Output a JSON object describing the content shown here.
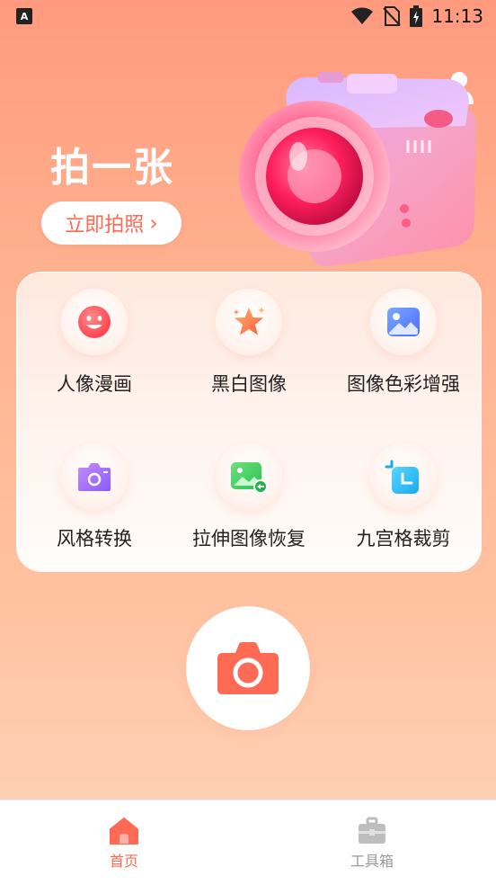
{
  "status_bar": {
    "left_icon_label": "A",
    "time": "11:13"
  },
  "hero": {
    "title": "拍一张",
    "button_label": "立即拍照",
    "button_chevron": "›"
  },
  "features": [
    {
      "label": "人像漫画",
      "icon": "smiley-face-icon"
    },
    {
      "label": "黑白图像",
      "icon": "star-icon"
    },
    {
      "label": "图像色彩增强",
      "icon": "picture-icon"
    },
    {
      "label": "风格转换",
      "icon": "purple-camera-icon"
    },
    {
      "label": "拉伸图像恢复",
      "icon": "green-image-restore-icon"
    },
    {
      "label": "九宫格裁剪",
      "icon": "crop-icon"
    }
  ],
  "bottom_nav": {
    "items": [
      {
        "label": "首页",
        "icon": "home-icon",
        "active": true
      },
      {
        "label": "工具箱",
        "icon": "toolbox-icon",
        "active": false
      }
    ]
  },
  "colors": {
    "accent": "#ff6a55",
    "inactive": "#999999"
  }
}
